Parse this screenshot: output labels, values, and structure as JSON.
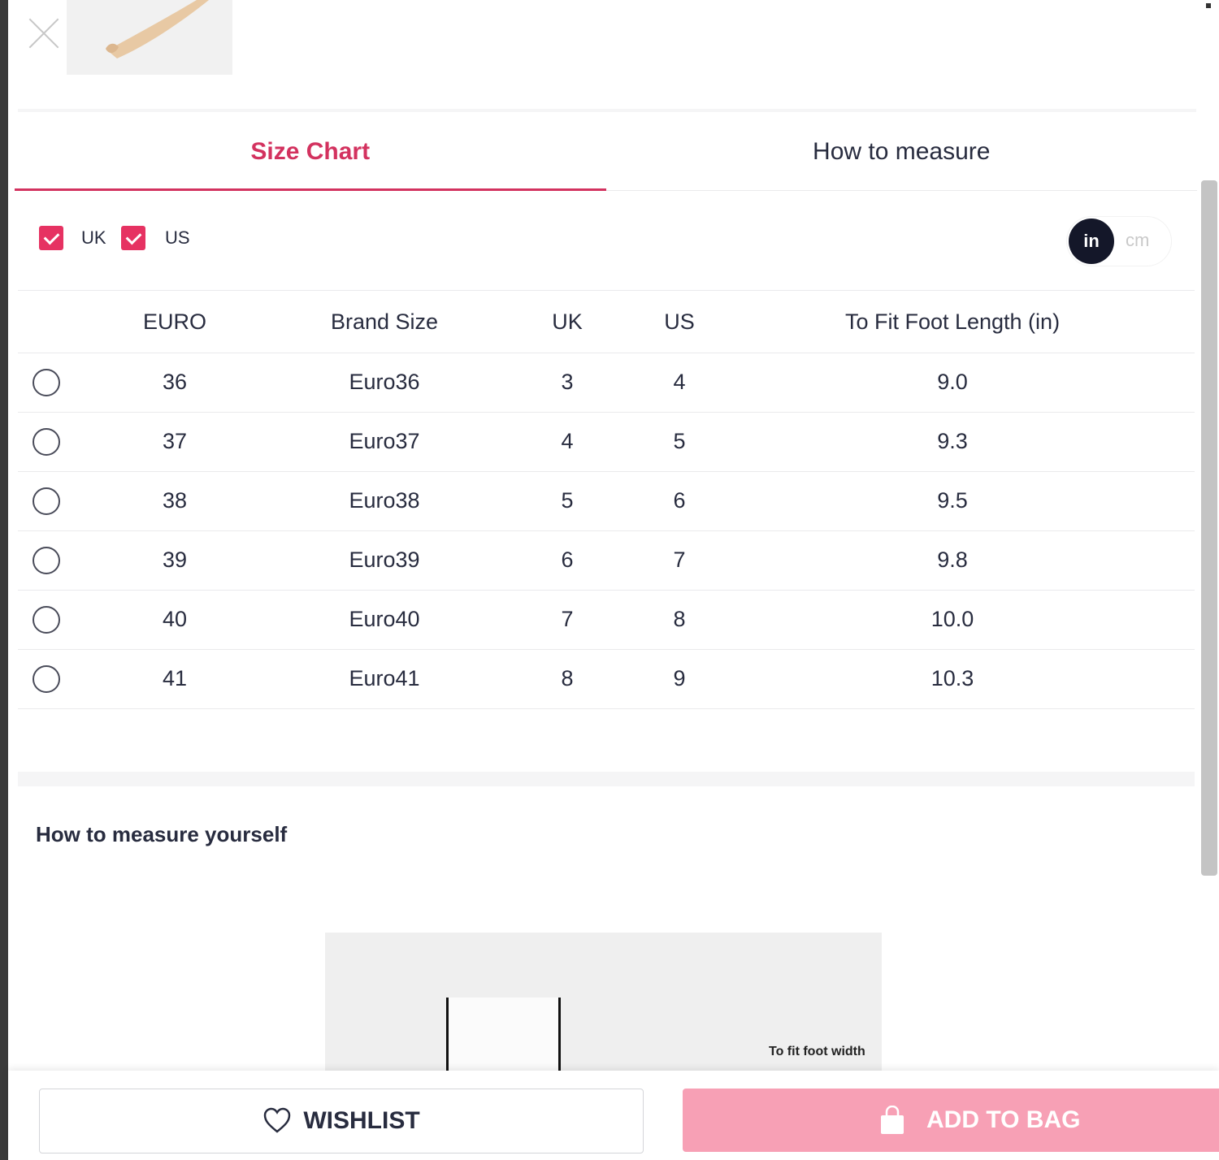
{
  "tabs": [
    {
      "label": "Size Chart",
      "active": true
    },
    {
      "label": "How to measure",
      "active": false
    }
  ],
  "filters": {
    "uk_label": "UK",
    "us_label": "US",
    "uk_checked": true,
    "us_checked": true
  },
  "units": {
    "inch_label": "in",
    "cm_label": "cm",
    "selected": "in"
  },
  "table": {
    "headers": [
      "EURO",
      "Brand Size",
      "UK",
      "US",
      "To Fit Foot Length (in)"
    ],
    "rows": [
      {
        "euro": "36",
        "brand": "Euro36",
        "uk": "3",
        "us": "4",
        "foot": "9.0"
      },
      {
        "euro": "37",
        "brand": "Euro37",
        "uk": "4",
        "us": "5",
        "foot": "9.3"
      },
      {
        "euro": "38",
        "brand": "Euro38",
        "uk": "5",
        "us": "6",
        "foot": "9.5"
      },
      {
        "euro": "39",
        "brand": "Euro39",
        "uk": "6",
        "us": "7",
        "foot": "9.8"
      },
      {
        "euro": "40",
        "brand": "Euro40",
        "uk": "7",
        "us": "8",
        "foot": "10.0"
      },
      {
        "euro": "41",
        "brand": "Euro41",
        "uk": "8",
        "us": "9",
        "foot": "10.3"
      }
    ]
  },
  "measure": {
    "title": "How to measure yourself",
    "caption": "To fit foot width"
  },
  "footer": {
    "wishlist_label": "WISHLIST",
    "add_to_bag_label": "ADD TO BAG"
  },
  "colors": {
    "accent": "#d3325f",
    "checkbox": "#e63262",
    "add_to_bag_bg": "#f7a0b5",
    "unit_selected_bg": "#141729"
  },
  "icons": {
    "close": "close-icon",
    "heart": "heart-icon",
    "bag": "bag-icon"
  }
}
